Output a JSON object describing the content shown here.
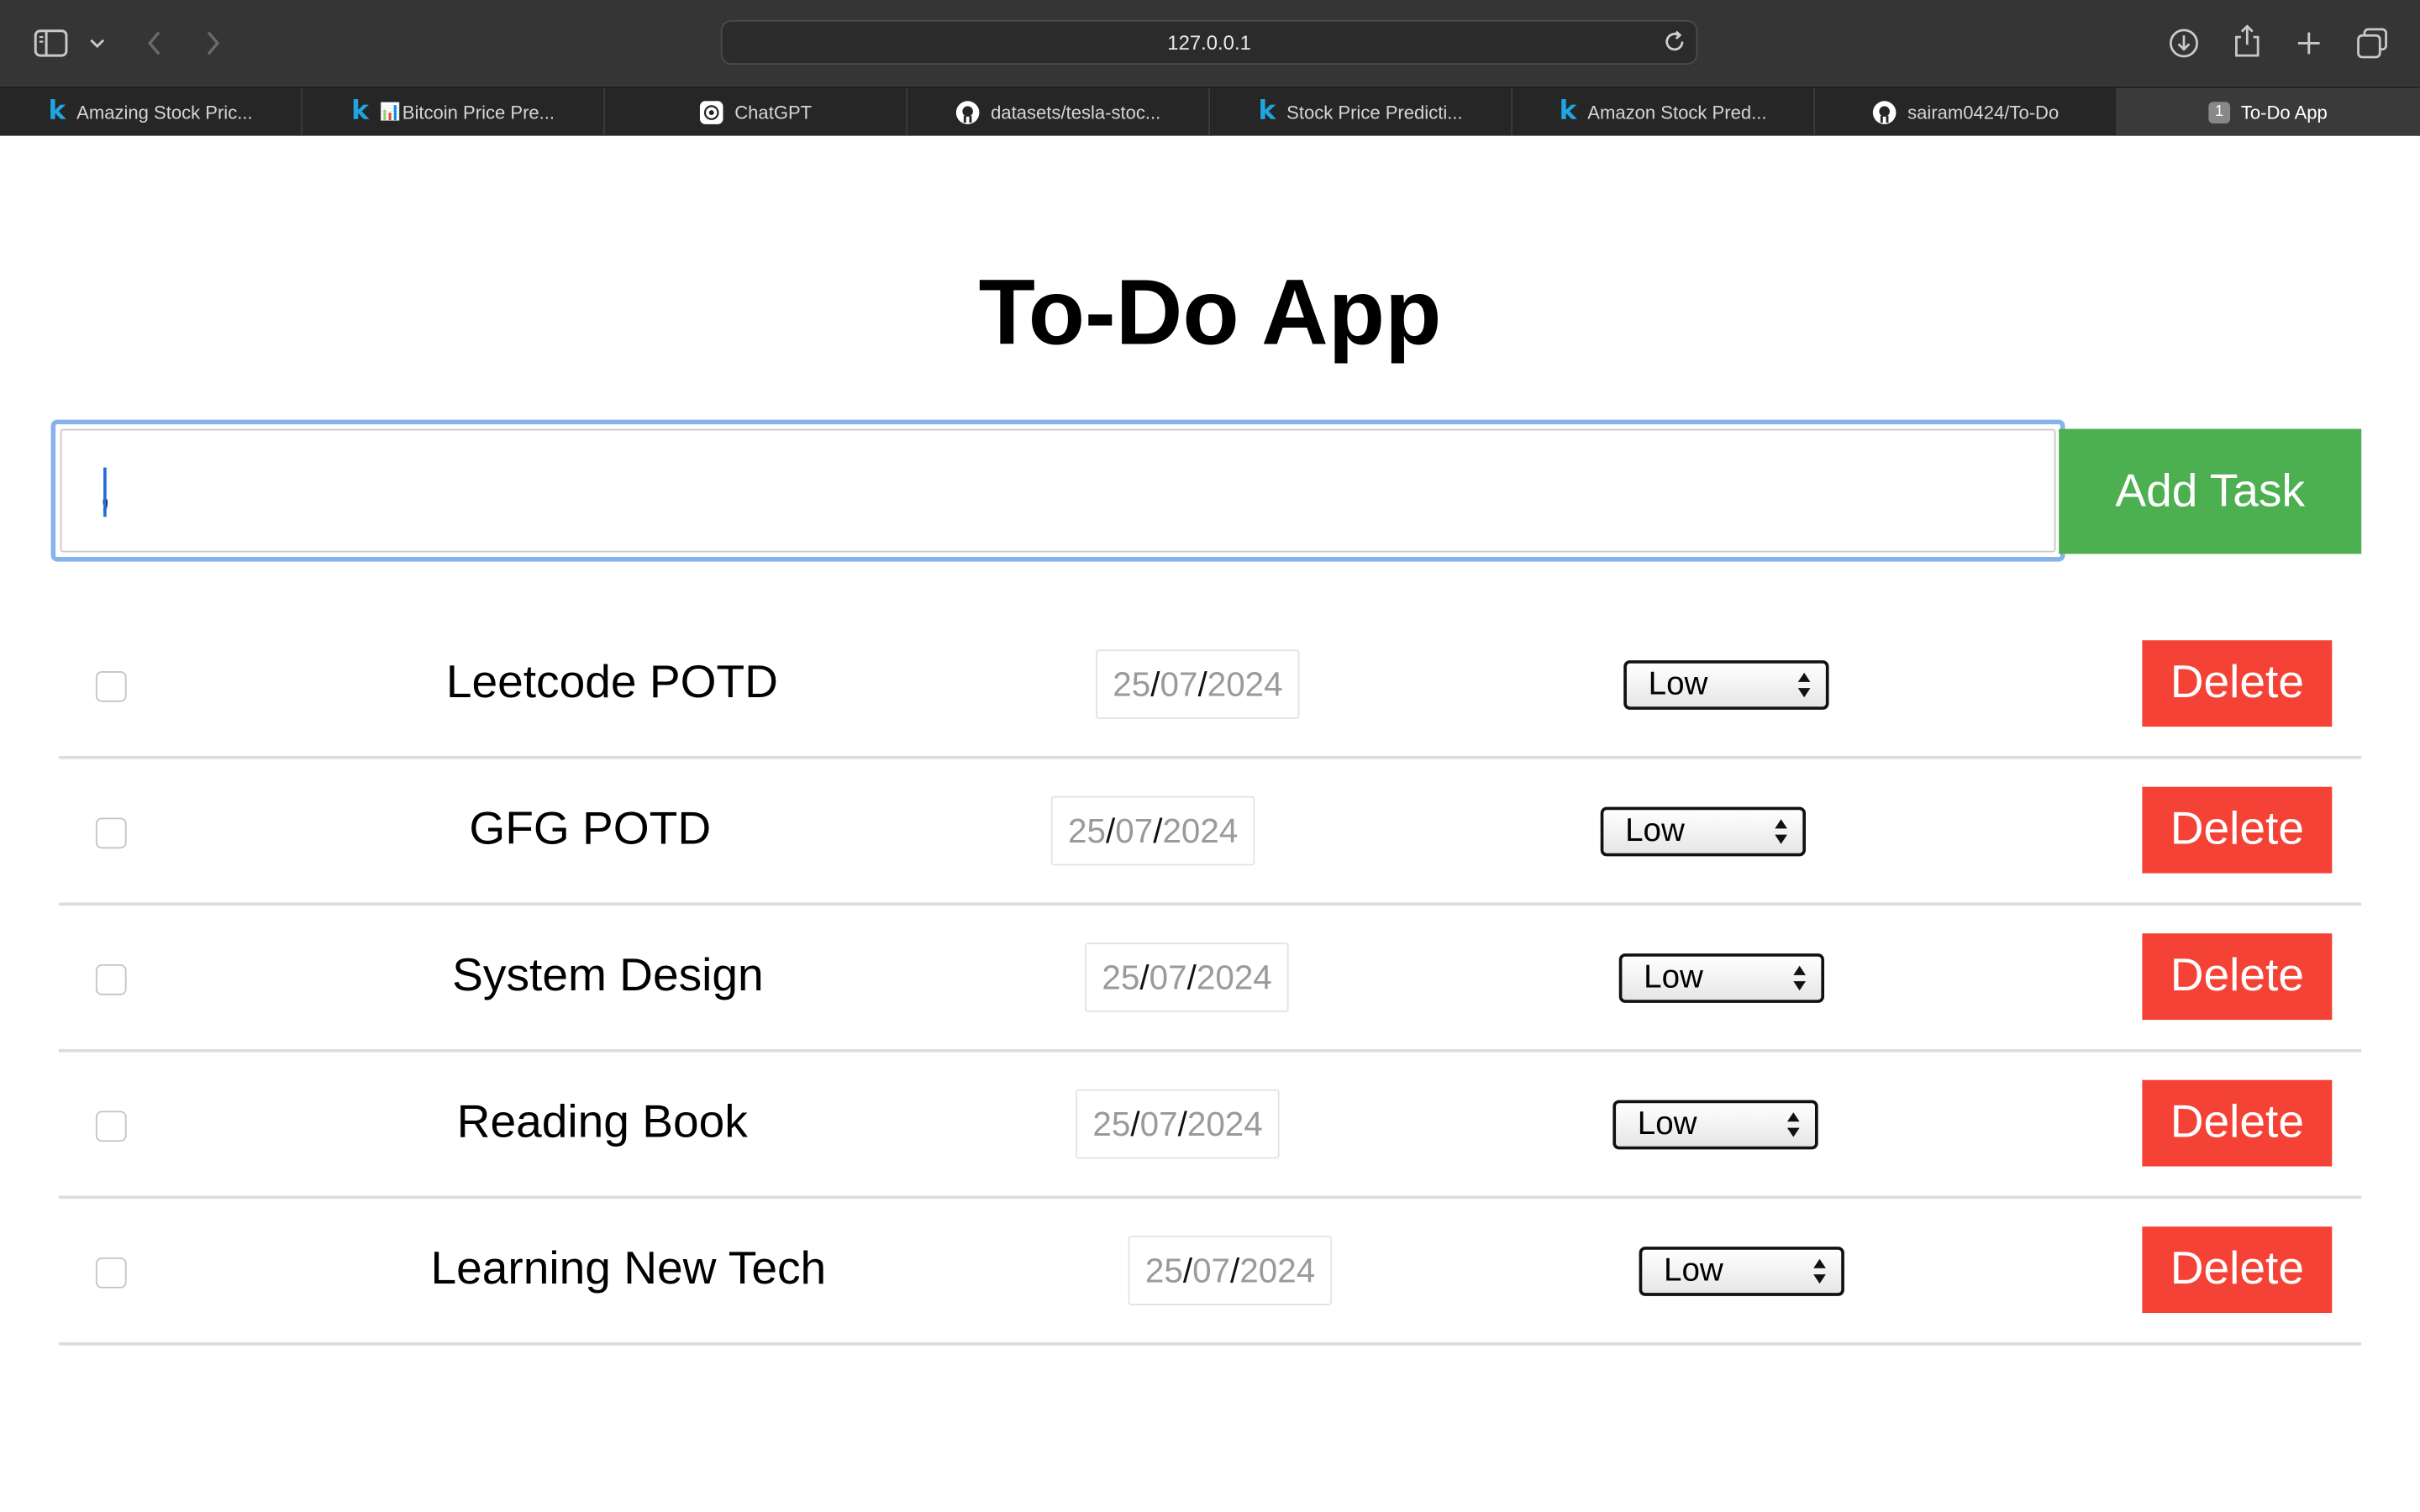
{
  "browser": {
    "address": "127.0.0.1",
    "tabs": [
      {
        "label": "Amazing Stock Pric...",
        "icon": "kaggle-icon"
      },
      {
        "label": "Bitcoin Price Pre...",
        "icon": "chart-icon",
        "prefix": "📊"
      },
      {
        "label": "ChatGPT",
        "icon": "chatgpt-icon"
      },
      {
        "label": "datasets/tesla-stoc...",
        "icon": "github-icon"
      },
      {
        "label": "Stock Price Predicti...",
        "icon": "kaggle-icon"
      },
      {
        "label": "Amazon Stock Pred...",
        "icon": "kaggle-icon"
      },
      {
        "label": "sairam0424/To-Do",
        "icon": "github-icon"
      },
      {
        "label": "To-Do App",
        "icon": "tab-number-icon",
        "badge": "1",
        "active": true
      }
    ]
  },
  "app": {
    "title": "To-Do App",
    "input_value": ",",
    "add_label": "Add Task",
    "delete_label": "Delete",
    "tasks": [
      {
        "text": "Leetcode POTD",
        "date": {
          "d": "25",
          "m": "07",
          "y": "2024"
        },
        "priority": "Low",
        "done": false
      },
      {
        "text": "GFG POTD",
        "date": {
          "d": "25",
          "m": "07",
          "y": "2024"
        },
        "priority": "Low",
        "done": false
      },
      {
        "text": "System Design",
        "date": {
          "d": "25",
          "m": "07",
          "y": "2024"
        },
        "priority": "Low",
        "done": false
      },
      {
        "text": "Reading Book",
        "date": {
          "d": "25",
          "m": "07",
          "y": "2024"
        },
        "priority": "Low",
        "done": false
      },
      {
        "text": "Learning New Tech",
        "date": {
          "d": "25",
          "m": "07",
          "y": "2024"
        },
        "priority": "Low",
        "done": false
      }
    ]
  },
  "colors": {
    "add_button": "#4caf50",
    "delete_button": "#f44336",
    "focus_ring": "#86b3ea"
  }
}
